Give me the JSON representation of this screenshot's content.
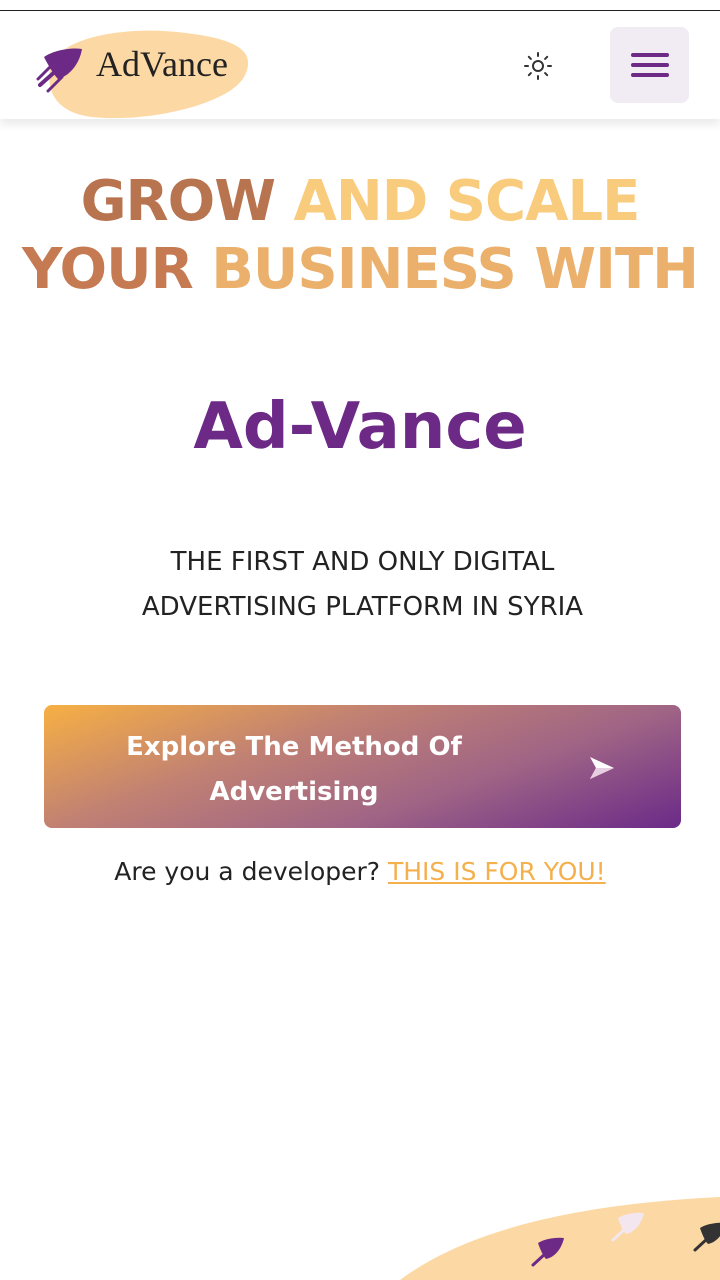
{
  "header": {
    "brand": "AdVance",
    "logo_icon": "rocket-icon",
    "theme_icon": "sun-icon",
    "menu_icon": "hamburger-menu-icon"
  },
  "hero": {
    "title_line1_a": "GROW",
    "title_line1_b": "AND SCALE",
    "title_line2_a": "YOUR",
    "title_line2_b": "BUSINESS WITH",
    "brand_name": "Ad-Vance",
    "subtitle": "THE FIRST AND ONLY DIGITAL ADVERTISING PLATFORM IN SYRIA"
  },
  "cta": {
    "label": "Explore The Method Of Advertising",
    "icon": "send-arrow-icon"
  },
  "developer": {
    "question": "Are you a developer? ",
    "link_text": "THIS IS FOR YOU!"
  },
  "colors": {
    "brand_purple": "#6c2a86",
    "accent_orange": "#f9cb7d",
    "link_orange": "#f5b04e",
    "menu_bg": "#f1ebf4"
  }
}
